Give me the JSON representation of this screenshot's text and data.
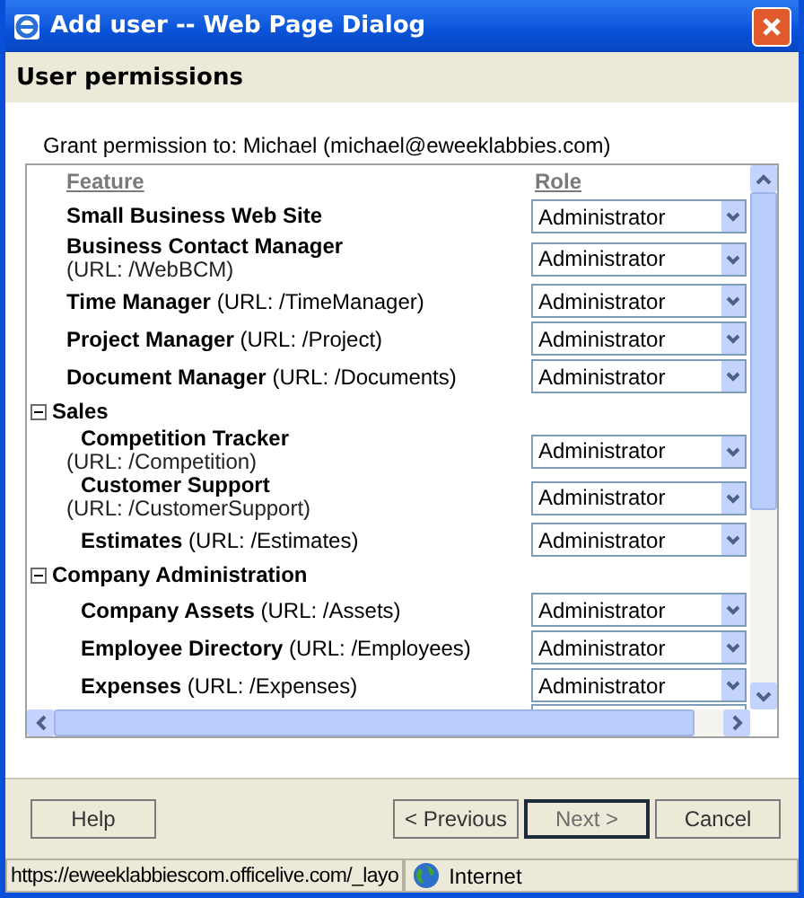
{
  "window": {
    "title": "Add user -- Web Page Dialog"
  },
  "header": "User permissions",
  "grant": "Grant permission to: Michael (michael@eweeklabbies.com)",
  "columns": [
    "Feature",
    "Role"
  ],
  "groups": [
    {
      "items": [
        {
          "kind": "plain",
          "name": "Small Business Web Site",
          "role": "Administrator"
        },
        {
          "kind": "stacked",
          "name": "Business Contact Manager",
          "url": "(URL: /WebBCM)",
          "role": "Administrator"
        },
        {
          "kind": "inline",
          "name": "Time Manager",
          "url": "(URL: /TimeManager)",
          "role": "Administrator"
        },
        {
          "kind": "inline",
          "name": "Project Manager",
          "url": "(URL: /Project)",
          "role": "Administrator"
        },
        {
          "kind": "inline",
          "name": "Document Manager",
          "url": "(URL: /Documents)",
          "role": "Administrator"
        }
      ]
    },
    {
      "title": "Sales",
      "expanded": true,
      "items": [
        {
          "kind": "stacked",
          "name": "Competition Tracker",
          "url": "(URL: /Competition)",
          "role": "Administrator"
        },
        {
          "kind": "stacked",
          "name": "Customer Support",
          "url": "(URL: /CustomerSupport)",
          "role": "Administrator"
        },
        {
          "kind": "inline",
          "name": "Estimates",
          "url": "(URL: /Estimates)",
          "role": "Administrator"
        }
      ]
    },
    {
      "title": "Company Administration",
      "expanded": true,
      "items": [
        {
          "kind": "inline",
          "name": "Company Assets",
          "url": "(URL: /Assets)",
          "role": "Administrator"
        },
        {
          "kind": "inline",
          "name": "Employee Directory",
          "url": "(URL: /Employees)",
          "role": "Administrator"
        },
        {
          "kind": "inline",
          "name": "Expenses",
          "url": "(URL: /Expenses)",
          "role": "Administrator"
        }
      ]
    }
  ],
  "buttons": [
    {
      "label": "Help",
      "default": false
    },
    {
      "label": "< Previous",
      "default": false
    },
    {
      "label": "Next >",
      "default": true
    },
    {
      "label": "Cancel",
      "default": false
    }
  ],
  "status_bar": {
    "url": "https://eweeklabbiescom.officelive.com/_layo",
    "zone": "Internet"
  }
}
